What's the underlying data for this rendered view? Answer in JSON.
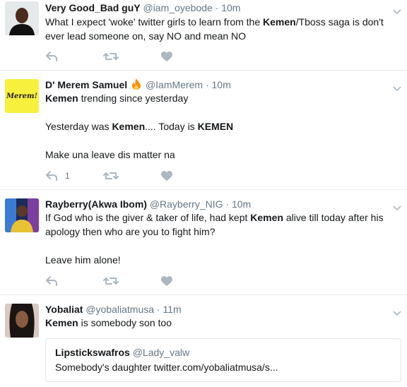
{
  "tweets": [
    {
      "fullname": "Very Good_Bad guY",
      "screen_name": "@iam_oyebode",
      "time": "10m",
      "segments": [
        {
          "t": "What I expect 'woke' twitter girls to learn from the "
        },
        {
          "t": "Kemen",
          "b": true
        },
        {
          "t": "/Tboss saga is don't ever lead someone on, say NO and mean NO"
        }
      ]
    },
    {
      "fullname": "D' Merem Samuel",
      "emoji": "fire-icon",
      "screen_name": "@IamMerem",
      "time": "10m",
      "avatar_text": "Merem!",
      "line1": {
        "kw": "Kemen",
        "rest": " trending since yesterday"
      },
      "line2": {
        "a": "Yesterday was ",
        "kw1": "Kemen",
        "b": ".... Today is ",
        "kw2": "KEMEN"
      },
      "line3": "Make una leave dis matter na",
      "reply_count": "1"
    },
    {
      "fullname": "Rayberry(Akwa Ibom)",
      "screen_name": "@Rayberry_NIG",
      "time": "10m",
      "line1": {
        "a": "If God who is the giver & taker of life, had kept ",
        "kw": "Kemen",
        "b": " alive till today after his"
      },
      "line2": "apology then who are you to fight him?",
      "line3": "Leave him alone!"
    },
    {
      "fullname": "Yobaliat",
      "screen_name": "@yobaliatmusa",
      "time": "11m",
      "line1": {
        "kw": "Kemen",
        "rest": " is somebody son too"
      },
      "quote": {
        "fullname": "Lipstickswafros",
        "screen_name": "@Lady_valw",
        "text": "Somebody's daughter twitter.com/yobaliatmusa/s..."
      }
    }
  ],
  "separator": "·",
  "colors": {
    "text": "#14171a",
    "secondary": "#657786",
    "icon": "#aab8c2",
    "fire": "#f4900c",
    "merem_bg": "#f7f03c"
  }
}
